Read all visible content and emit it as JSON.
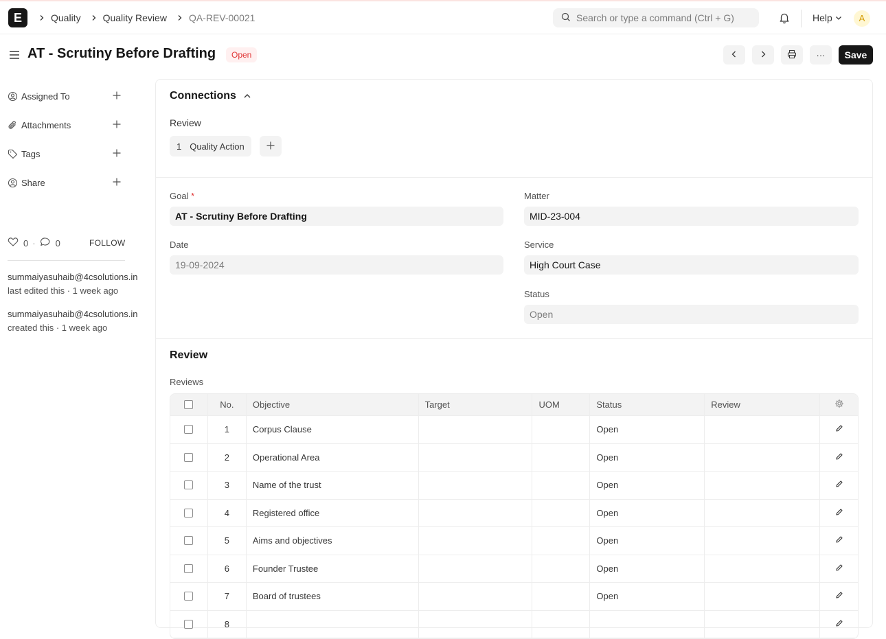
{
  "navbar": {
    "logo_letter": "E",
    "breadcrumbs": [
      "Quality",
      "Quality Review",
      "QA-REV-00021"
    ],
    "search_placeholder": "Search or type a command (Ctrl + G)",
    "help_label": "Help",
    "avatar_letter": "A"
  },
  "page": {
    "title": "AT - Scrutiny Before Drafting",
    "status": "Open",
    "save_label": "Save",
    "more_label": "···"
  },
  "sidebar": {
    "items": [
      {
        "label": "Assigned To",
        "icon": "user-assign-icon"
      },
      {
        "label": "Attachments",
        "icon": "paperclip-icon"
      },
      {
        "label": "Tags",
        "icon": "tag-icon"
      },
      {
        "label": "Share",
        "icon": "share-user-icon"
      }
    ],
    "likes": "0",
    "comments": "0",
    "dot": "·",
    "follow_label": "FOLLOW",
    "activity": [
      {
        "user": "summaiyasuhaib@4csolutions.in",
        "text": "last edited this · 1 week ago"
      },
      {
        "user": "summaiyasuhaib@4csolutions.in",
        "text": "created this · 1 week ago"
      }
    ]
  },
  "connections": {
    "title": "Connections",
    "group_label": "Review",
    "link_count": "1",
    "link_label": "Quality Action"
  },
  "form": {
    "goal_label": "Goal",
    "goal_required": "*",
    "goal_value": "AT - Scrutiny Before Drafting",
    "date_label": "Date",
    "date_value": "19-09-2024",
    "matter_label": "Matter",
    "matter_value": "MID-23-004",
    "service_label": "Service",
    "service_value": "High Court Case",
    "status_label": "Status",
    "status_value": "Open"
  },
  "review": {
    "section_title": "Review",
    "table_label": "Reviews",
    "columns": [
      "No.",
      "Objective",
      "Target",
      "UOM",
      "Status",
      "Review"
    ],
    "rows": [
      {
        "no": "1",
        "objective": "Corpus Clause",
        "target": "",
        "uom": "",
        "status": "Open",
        "review": ""
      },
      {
        "no": "2",
        "objective": "Operational Area",
        "target": "",
        "uom": "",
        "status": "Open",
        "review": ""
      },
      {
        "no": "3",
        "objective": "Name of the trust",
        "target": "",
        "uom": "",
        "status": "Open",
        "review": ""
      },
      {
        "no": "4",
        "objective": "Registered office",
        "target": "",
        "uom": "",
        "status": "Open",
        "review": ""
      },
      {
        "no": "5",
        "objective": "Aims and objectives",
        "target": "",
        "uom": "",
        "status": "Open",
        "review": ""
      },
      {
        "no": "6",
        "objective": "Founder Trustee",
        "target": "",
        "uom": "",
        "status": "Open",
        "review": ""
      },
      {
        "no": "7",
        "objective": "Board of trustees",
        "target": "",
        "uom": "",
        "status": "Open",
        "review": ""
      },
      {
        "no": "8",
        "objective": "",
        "target": "",
        "uom": "",
        "status": "",
        "review": ""
      }
    ]
  }
}
